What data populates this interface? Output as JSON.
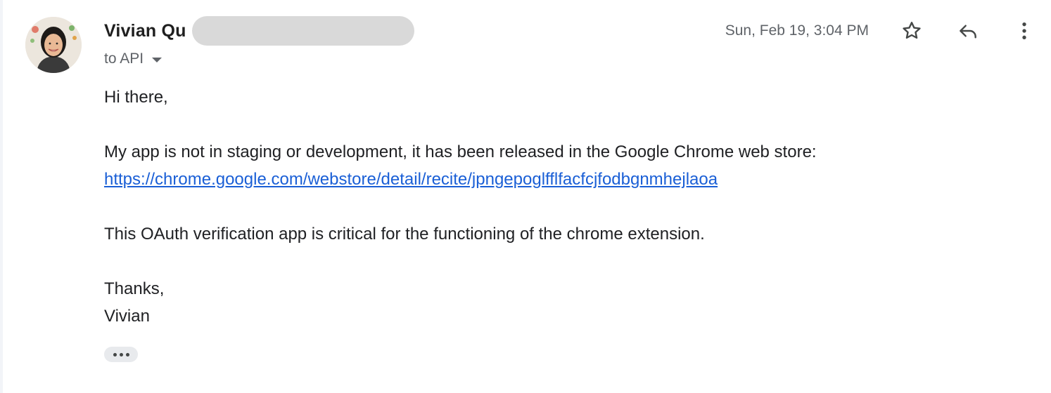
{
  "message": {
    "sender_name": "Vivian Qu",
    "recipient_label": "to API",
    "date": "Sun, Feb 19, 3:04 PM",
    "body": {
      "greeting": "Hi there,",
      "para1_text": "My app is not in staging or development, it has been released in the Google Chrome web store: ",
      "para1_link": "https://chrome.google.com/webstore/detail/recite/jpngepoglfflfacfcjfodbgnmhejlaoa",
      "para2": "This OAuth verification app is critical for the functioning of the chrome extension.",
      "closing": "Thanks,",
      "signature": "Vivian"
    }
  },
  "icons": {
    "avatar": "avatar-photo",
    "star": "star-icon",
    "reply": "reply-icon",
    "more": "more-vert-icon",
    "recipient_caret": "caret-down-icon",
    "trimmed_content": "more-horiz-icon"
  },
  "colors": {
    "link": "#1a5fd6",
    "secondary_text": "#5f6368",
    "primary_text": "#202124",
    "redaction": "#d9d9d9"
  }
}
